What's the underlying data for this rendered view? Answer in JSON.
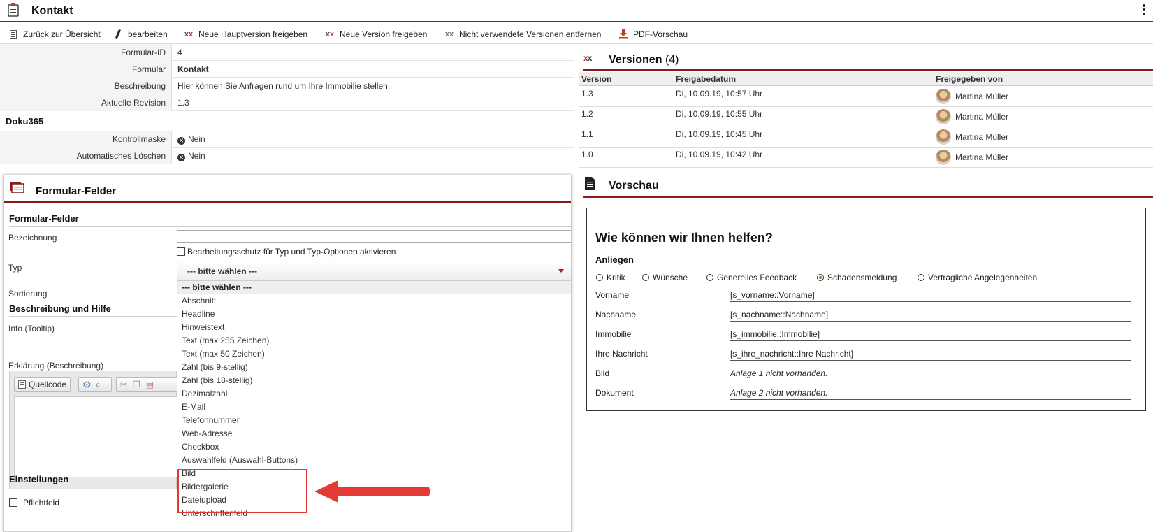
{
  "header": {
    "title": "Kontakt"
  },
  "toolbar": {
    "back": "Zurück zur Übersicht",
    "edit": "bearbeiten",
    "release_major": "Neue Hauptversion freigeben",
    "release_version": "Neue Version freigeben",
    "remove_unused": "Nicht verwendete Versionen entfernen",
    "pdf": "PDF-Vorschau"
  },
  "info": {
    "rows": [
      {
        "label": "Formular-ID",
        "value": "4"
      },
      {
        "label": "Formular",
        "value": "Kontakt"
      },
      {
        "label": "Beschreibung",
        "value": "Hier können Sie Anfragen rund um Ihre Immobilie stellen."
      },
      {
        "label": "Aktuelle Revision",
        "value": "1.3"
      }
    ],
    "doku_heading": "Doku365",
    "doku_rows": [
      {
        "label": "Kontrollmaske",
        "value": "Nein"
      },
      {
        "label": "Automatisches Löschen",
        "value": "Nein"
      }
    ]
  },
  "versions": {
    "title": "Versionen",
    "count": "(4)",
    "columns": [
      "Version",
      "Freigabedatum",
      "Freigegeben von"
    ],
    "rows": [
      {
        "version": "1.3",
        "date": "Di, 10.09.19, 10:57 Uhr",
        "by": "Martina Müller"
      },
      {
        "version": "1.2",
        "date": "Di, 10.09.19, 10:55 Uhr",
        "by": "Martina Müller"
      },
      {
        "version": "1.1",
        "date": "Di, 10.09.19, 10:45 Uhr",
        "by": "Martina Müller"
      },
      {
        "version": "1.0",
        "date": "Di, 10.09.19, 10:42 Uhr",
        "by": "Martina Müller"
      }
    ]
  },
  "preview": {
    "title": "Vorschau",
    "question": "Wie können wir Ihnen helfen?",
    "group_label": "Anliegen",
    "options": [
      {
        "label": "Kritik",
        "checked": false
      },
      {
        "label": "Wünsche",
        "checked": false
      },
      {
        "label": "Generelles Feedback",
        "checked": false
      },
      {
        "label": "Schadensmeldung",
        "checked": true
      },
      {
        "label": "Vertragliche Angelegenheiten",
        "checked": false
      }
    ],
    "fields": [
      {
        "label": "Vorname",
        "value": "[s_vorname::Vorname]"
      },
      {
        "label": "Nachname",
        "value": "[s_nachname::Nachname]"
      },
      {
        "label": "Immobilie",
        "value": "[s_immobilie::Immobilie]"
      },
      {
        "label": "Ihre Nachricht",
        "value": "[s_ihre_nachricht::Ihre Nachricht]"
      },
      {
        "label": "Bild",
        "value": "Anlage 1 nicht vorhanden."
      },
      {
        "label": "Dokument",
        "value": "Anlage 2 nicht vorhanden."
      }
    ]
  },
  "form_fields": {
    "panel_title": "Formular-Felder",
    "section_title": "Formular-Felder",
    "bezeichnung_label": "Bezeichnung",
    "bezeichnung_value": "",
    "protect_label": "Bearbeitungsschutz für Typ und Typ-Optionen aktivieren",
    "typ_label": "Typ",
    "typ_selected": "--- bitte wählen ---",
    "sortierung_label": "Sortierung",
    "desc_section": "Beschreibung und Hilfe",
    "info_label": "Info (Tooltip)",
    "erklaerung_label": "Erklärung (Beschreibung)",
    "editor_source": "Quellcode",
    "settings_section": "Einstellungen",
    "pflicht_label": "Pflichtfeld",
    "typ_options": [
      "--- bitte wählen ---",
      "Abschnitt",
      "Headline",
      "Hinweistext",
      "Text (max 255 Zeichen)",
      "Text (max 50 Zeichen)",
      "Zahl (bis 9-stellig)",
      "Zahl (bis 18-stellig)",
      "Dezimalzahl",
      "E-Mail",
      "Telefonnummer",
      "Web-Adresse",
      "Checkbox",
      "Auswahlfeld (Auswahl-Buttons)",
      "Bild",
      "Bildergalerie",
      "Dateiupload",
      "Unterschriftenfeld"
    ]
  },
  "colors": {
    "accent": "#8b1a1a",
    "highlight": "#e53935",
    "radio_on": "#4a9a2a"
  },
  "icons": [
    "clipboard-icon",
    "kebab-menu-icon",
    "list-icon",
    "pencil-icon",
    "release-icon",
    "pdf-icon",
    "nein-icon",
    "document-icon",
    "form-icon"
  ]
}
